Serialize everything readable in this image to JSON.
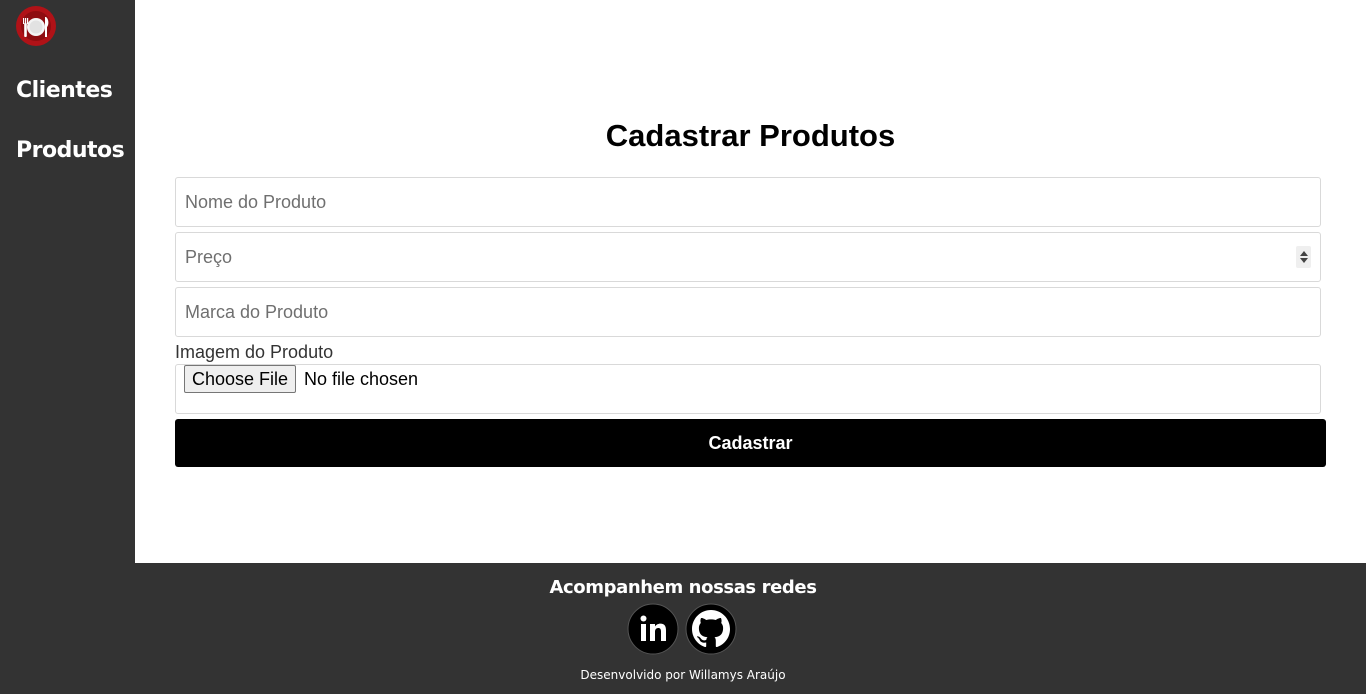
{
  "sidebar": {
    "logo_icon": "restaurant-plate-icon",
    "items": [
      {
        "label": "Clientes"
      },
      {
        "label": "Produtos"
      }
    ]
  },
  "main": {
    "title": "Cadastrar Produtos",
    "form": {
      "name_placeholder": "Nome do Produto",
      "name_value": "",
      "price_placeholder": "Preço",
      "price_value": "",
      "brand_placeholder": "Marca do Produto",
      "brand_value": "",
      "image_label": "Imagem do Produto",
      "file_button_label": "Choose File",
      "file_status": "No file chosen",
      "submit_label": "Cadastrar"
    }
  },
  "footer": {
    "title": "Acompanhem nossas redes",
    "social": [
      {
        "icon": "linkedin-icon"
      },
      {
        "icon": "github-icon"
      }
    ],
    "credit": "Desenvolvido por Willamys Araújo"
  },
  "colors": {
    "sidebar_bg": "#333333",
    "footer_bg": "#333333",
    "button_bg": "#000000",
    "logo_red": "#b01217"
  }
}
